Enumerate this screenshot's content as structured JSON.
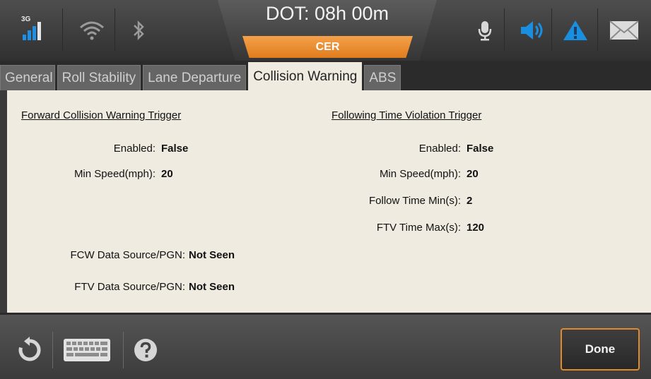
{
  "status": {
    "network": "3G",
    "dot_title": "DOT: 08h 00m",
    "cer_label": "CER",
    "icons": [
      "signal-icon",
      "wifi-icon",
      "bluetooth-icon",
      "microphone-icon",
      "speaker-icon",
      "alert-icon",
      "mail-icon"
    ],
    "accent_color": "#e8892a",
    "active_icon_color": "#1a8fe0"
  },
  "tabs": [
    {
      "label": "General"
    },
    {
      "label": "Roll Stability"
    },
    {
      "label": "Lane Departure"
    },
    {
      "label": "Collision Warning",
      "active": true
    },
    {
      "label": "ABS"
    }
  ],
  "fcw": {
    "title": "Forward Collision Warning Trigger",
    "enabled_label": "Enabled:",
    "enabled_value": "False",
    "min_speed_label": "Min Speed(mph):",
    "min_speed_value": "20"
  },
  "ftv": {
    "title": "Following Time Violation Trigger",
    "enabled_label": "Enabled:",
    "enabled_value": "False",
    "min_speed_label": "Min Speed(mph):",
    "min_speed_value": "20",
    "follow_min_label": "Follow Time Min(s):",
    "follow_min_value": "2",
    "ftv_max_label": "FTV Time Max(s):",
    "ftv_max_value": "120"
  },
  "sources": {
    "fcw_label": "FCW Data Source/PGN:",
    "fcw_value": "Not Seen",
    "ftv_label": "FTV Data Source/PGN:",
    "ftv_value": "Not Seen"
  },
  "bottom": {
    "done_label": "Done",
    "icons": [
      "refresh-icon",
      "keyboard-icon",
      "help-icon"
    ]
  }
}
